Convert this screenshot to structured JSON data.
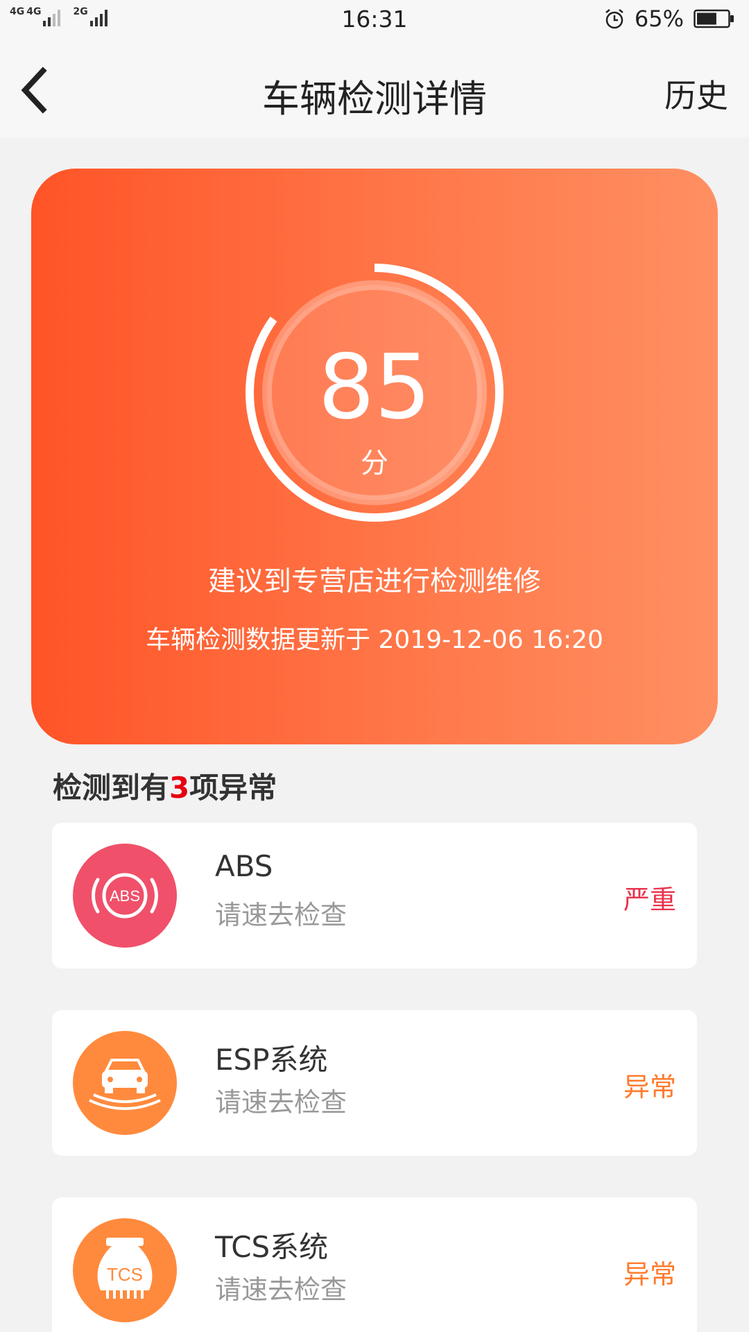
{
  "status_bar": {
    "network1": "4G",
    "network2": "4G",
    "network3": "2G",
    "time": "16:31",
    "battery": "65%",
    "alarm_icon": "alarm-clock-icon",
    "battery_level": 0.65
  },
  "nav": {
    "back_icon": "chevron-left-icon",
    "title": "车辆检测详情",
    "history_label": "历史"
  },
  "score": {
    "value": "85",
    "unit": "分",
    "progress": 0.85,
    "advice": "建议到专营店进行检测维修",
    "updated": "车辆检测数据更新于 2019-12-06 16:20"
  },
  "anomalies": {
    "prefix": "检测到有",
    "count": "3",
    "suffix": "项异常",
    "items": [
      {
        "name": "ABS",
        "desc": "请速去检查",
        "status": "严重",
        "status_color": "#e8344e",
        "icon": "abs-warning-icon",
        "icon_text": "ABS",
        "icon_color": "#f0506a"
      },
      {
        "name": "ESP系统",
        "desc": "请速去检查",
        "status": "异常",
        "status_color": "#ff7b2e",
        "icon": "esp-car-stability-icon",
        "icon_color": "#ff8a3d"
      },
      {
        "name": "TCS系统",
        "desc": "请速去检查",
        "status": "异常",
        "status_color": "#ff7b2e",
        "icon": "tcs-traction-control-icon",
        "icon_text": "TCS",
        "icon_color": "#ff8a3d"
      }
    ]
  },
  "colors": {
    "card_gradient_start": "#ff5427",
    "card_gradient_end": "#ff8f62",
    "highlight_red": "#e60012"
  }
}
